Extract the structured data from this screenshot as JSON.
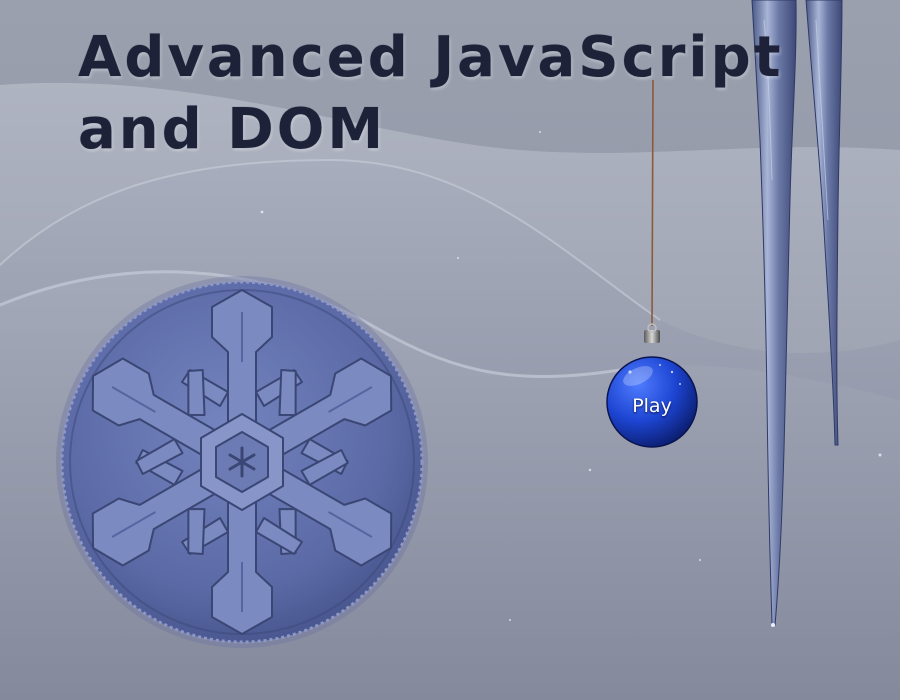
{
  "title": {
    "line1": "Advanced JavaScript",
    "line2": "and DOM"
  },
  "ornament": {
    "label": "Play",
    "icon": "ornament-icon",
    "color": "#1f48d6"
  },
  "colors": {
    "snow_light": "#b4b9c7",
    "snow_shadow": "#7b8196",
    "disc": "#5a6aa8",
    "title": "#1e2238"
  },
  "decorations": {
    "snowflake": "snowflake-icon",
    "icicle": "icicle-icon"
  }
}
